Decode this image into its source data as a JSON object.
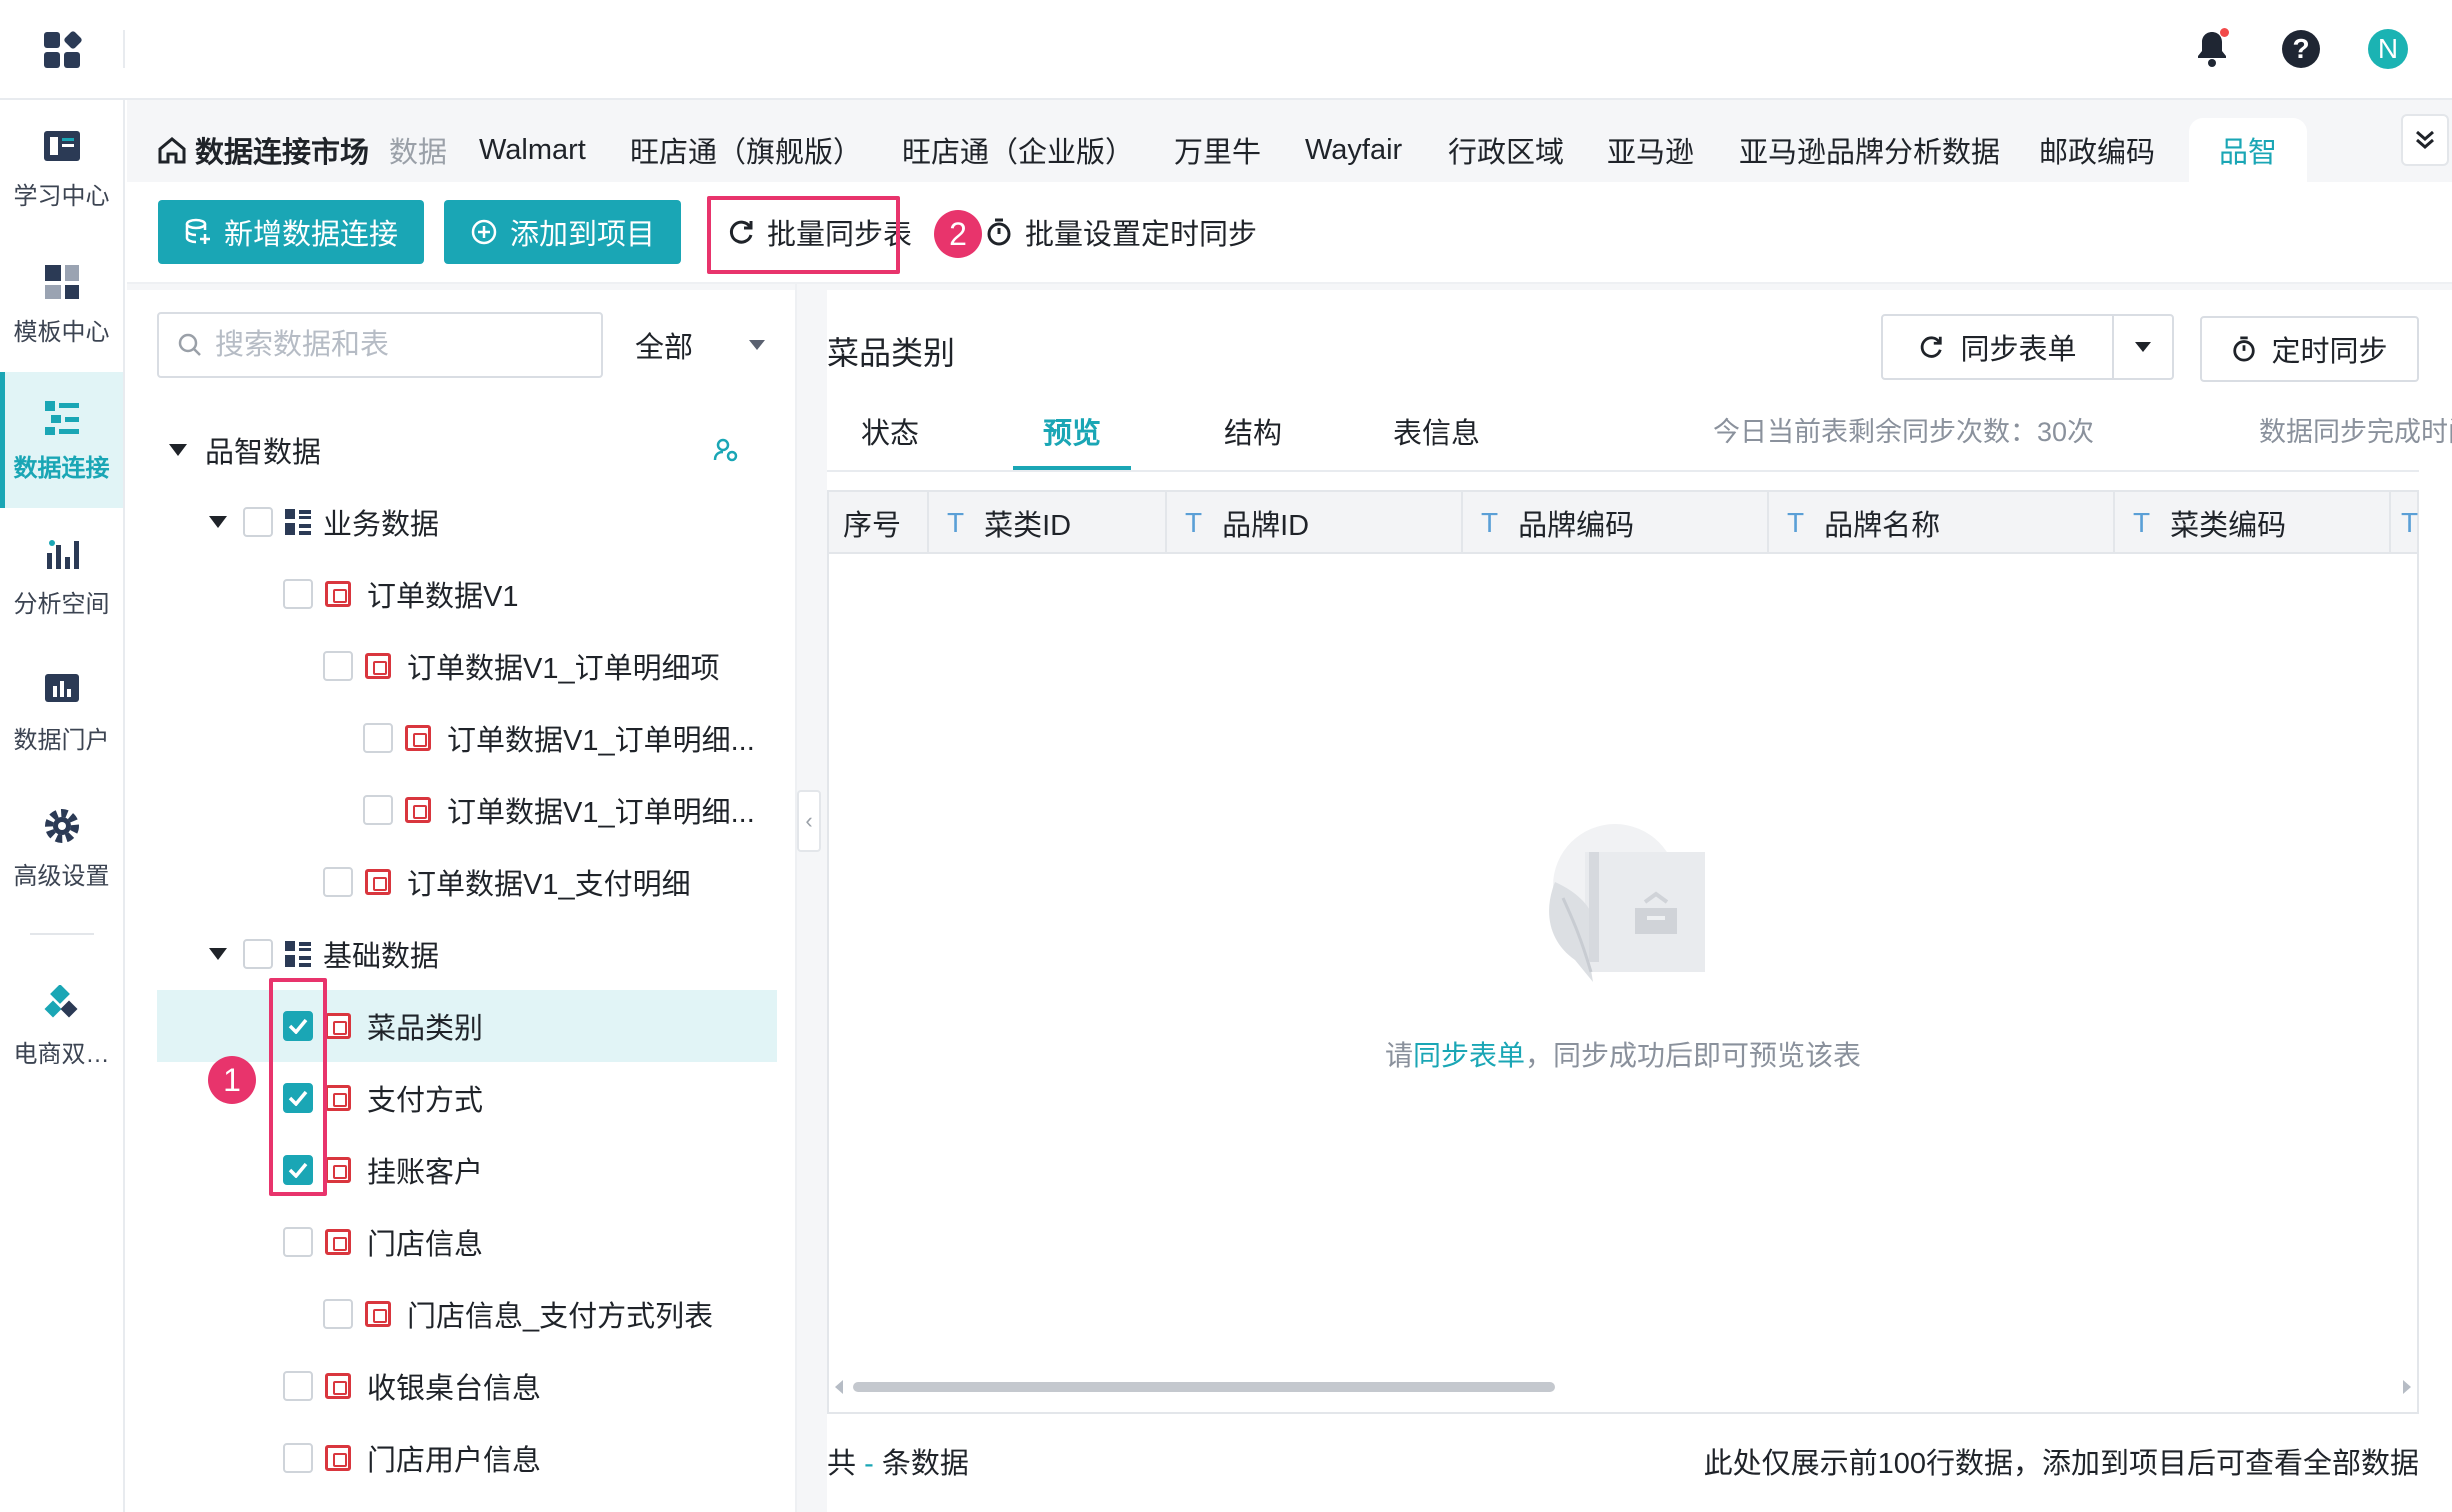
{
  "sidebar": {
    "items": [
      {
        "label": "学习中心",
        "icon": "book-icon"
      },
      {
        "label": "模板中心",
        "icon": "template-icon"
      },
      {
        "label": "数据连接",
        "icon": "data-connection-icon",
        "active": true
      },
      {
        "label": "分析空间",
        "icon": "analysis-icon"
      },
      {
        "label": "数据门户",
        "icon": "portal-icon"
      },
      {
        "label": "高级设置",
        "icon": "gear-icon"
      },
      {
        "label": "电商双…",
        "icon": "ecommerce-icon"
      }
    ]
  },
  "topbar": {
    "avatar_letter": "N"
  },
  "tabs": {
    "home": "数据连接市场",
    "items": [
      "数据",
      "Walmart",
      "旺店通（旗舰版）",
      "旺店通（企业版）",
      "万里牛",
      "Wayfair",
      "行政区域",
      "亚马逊",
      "亚马逊品牌分析数据",
      "邮政编码",
      "品智"
    ],
    "active": "品智"
  },
  "toolbar": {
    "new_connection": "新增数据连接",
    "add_to_project": "添加到项目",
    "batch_sync": "批量同步表",
    "batch_timer": "批量设置定时同步",
    "badge1": "1",
    "badge2": "2"
  },
  "left": {
    "search_placeholder": "搜索数据和表",
    "filter": "全部",
    "root": "品智数据",
    "group1": "业务数据",
    "group1_items": [
      "订单数据V1",
      "订单数据V1_订单明细项",
      "订单数据V1_订单明细...",
      "订单数据V1_订单明细...",
      "订单数据V1_支付明细"
    ],
    "group2": "基础数据",
    "group2_items": [
      "菜品类别",
      "支付方式",
      "挂账客户",
      "门店信息",
      "门店信息_支付方式列表",
      "收银桌台信息",
      "门店用户信息"
    ]
  },
  "right": {
    "title": "菜品类别",
    "sync_btn": "同步表单",
    "timer_btn": "定时同步",
    "tabs": [
      "状态",
      "预览",
      "结构",
      "表信息"
    ],
    "active_tab": "预览",
    "remaining_label": "今日当前表剩余同步次数：30次",
    "finish_label": "数据同步完成时间：-",
    "columns": [
      "序号",
      "菜类ID",
      "品牌ID",
      "品牌编码",
      "品牌名称",
      "菜类编码"
    ],
    "col_type": "T",
    "empty_prefix": "请",
    "empty_link": "同步表单",
    "empty_suffix": "，同步成功后即可预览该表",
    "footer_prefix": "共",
    "footer_dash": "-",
    "footer_suffix": "条数据",
    "footer_note": "此处仅展示前100行数据，添加到项目后可查看全部数据"
  },
  "colors": {
    "accent": "#1aa6b5",
    "highlight": "#e8346c",
    "table_icon": "#d9363e"
  }
}
